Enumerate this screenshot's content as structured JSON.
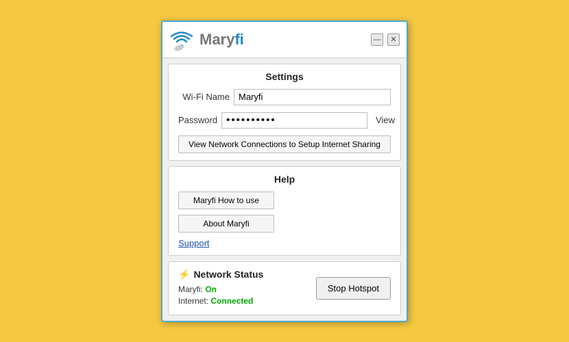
{
  "window": {
    "title": "Maryfi",
    "logo_text_gray": "Mary",
    "logo_text_blue": "fi",
    "minimize_label": "—",
    "close_label": "✕"
  },
  "settings": {
    "section_title": "Settings",
    "wifi_name_label": "Wi-Fi Name",
    "wifi_name_value": "Maryfi",
    "password_label": "Password",
    "password_value": "••••••••••",
    "view_label": "View",
    "network_btn_label": "View Network Connections to Setup Internet Sharing"
  },
  "help": {
    "section_title": "Help",
    "how_to_use_label": "Maryfi How to use",
    "about_label": "About Maryfi",
    "support_label": "Support"
  },
  "network_status": {
    "section_title": "Network Status",
    "maryfi_label": "Maryfi:",
    "maryfi_value": "On",
    "internet_label": "Internet:",
    "internet_value": "Connected",
    "stop_btn_label": "Stop Hotspot"
  }
}
